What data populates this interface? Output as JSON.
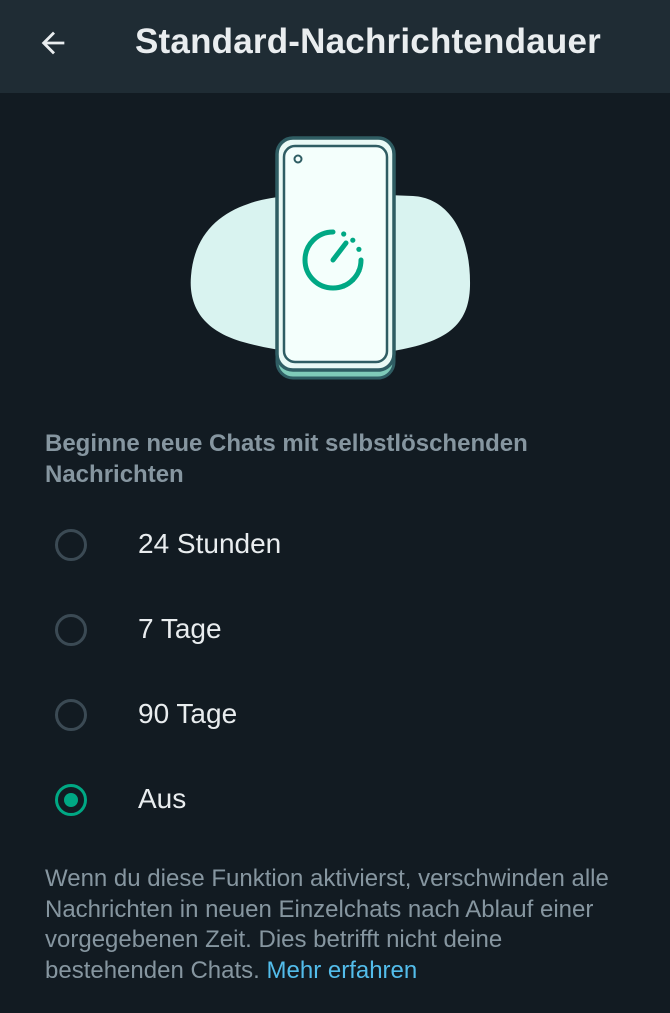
{
  "header": {
    "title": "Standard-Nachrichtendauer",
    "back_icon": "arrow-left-icon"
  },
  "illustration": {
    "icon": "timer-icon",
    "accent_color": "#00a884",
    "cloud_color": "#d9f3f0"
  },
  "section": {
    "label": "Beginne neue Chats mit selbstlöschenden Nachrichten"
  },
  "options": [
    {
      "label": "24 Stunden",
      "selected": false
    },
    {
      "label": "7 Tage",
      "selected": false
    },
    {
      "label": "90 Tage",
      "selected": false
    },
    {
      "label": "Aus",
      "selected": true
    }
  ],
  "footer": {
    "text": "Wenn du diese Funktion aktivierst, verschwinden alle Nachrichten in neuen Einzelchats nach Ablauf einer vorgegebenen Zeit. Dies betrifft nicht deine bestehenden Chats.",
    "link": "Mehr erfahren"
  },
  "colors": {
    "background": "#121b22",
    "appbar": "#1f2c34",
    "primary_text": "#e9edef",
    "secondary_text": "#8696a0",
    "link": "#53bdeb",
    "radio_selected": "#00a884",
    "radio_unselected": "#3b4a54"
  }
}
